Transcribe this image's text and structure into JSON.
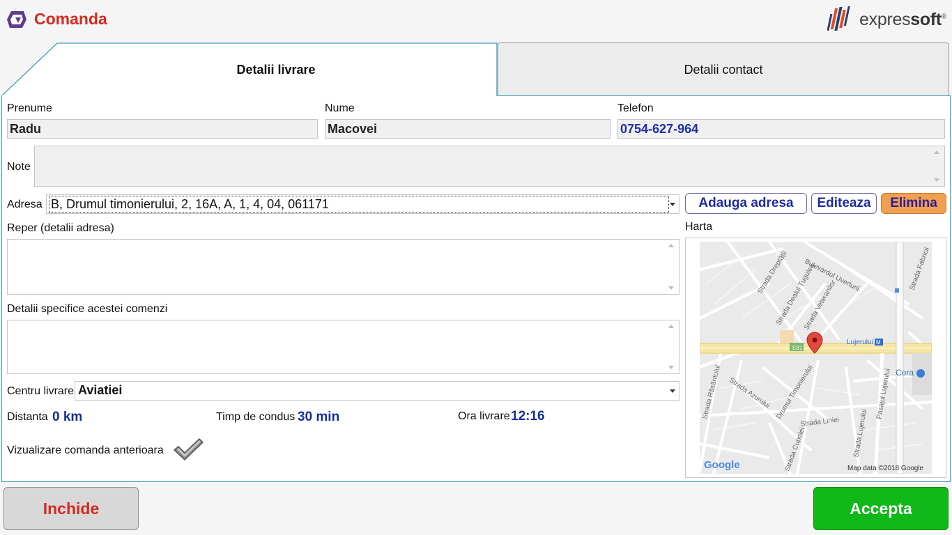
{
  "header": {
    "title": "Comanda",
    "brand_light": "expres",
    "brand_bold": "soft",
    "brand_mark": "®"
  },
  "tabs": [
    {
      "label": "Detalii livrare",
      "active": true
    },
    {
      "label": "Detalii contact",
      "active": false
    }
  ],
  "form": {
    "prenume_label": "Prenume",
    "prenume_value": "Radu",
    "nume_label": "Nume",
    "nume_value": "Macovei",
    "telefon_label": "Telefon",
    "telefon_value": "0754-627-964",
    "note_label": "Note",
    "adresa_label": "Adresa",
    "adresa_value": "B, Drumul timonierului, 2, 16A, A, 1, 4, 04, 061171",
    "reper_label": "Reper (detalii adresa)",
    "detalii_label": "Detalii specifice acestei comenzi",
    "centru_label": "Centru livrare",
    "centru_value": "Aviatiei",
    "distanta_label": "Distanta",
    "distanta_value": "0 km",
    "timp_label": "Timp de condus",
    "timp_value": "30 min",
    "ora_label": "Ora livrare",
    "ora_value": "12:16",
    "vizualizare_label": "Vizualizare comanda anterioara"
  },
  "buttons": {
    "adauga": "Adauga adresa",
    "editeaza": "Editeaza",
    "elimina": "Elimina",
    "inchide": "Inchide",
    "accepta": "Accepta"
  },
  "map": {
    "label": "Harta",
    "streets": [
      "Bulevardul Uverturii",
      "Strada Dreptății",
      "Strada Dealul Țugulea",
      "Strada Veteranilor",
      "Strada Fabricii",
      "Lujerului",
      "Cora",
      "Strada Răsăritului",
      "Strada Azurului",
      "Drumul Timonierului",
      "Strada Liniei",
      "Strada Cupolei",
      "Strada Lujerului",
      "Pasajul Lujerului"
    ],
    "road_badge": "E81",
    "metro_icon": "M",
    "google": "Google",
    "attribution": "Map data ©2018 Google"
  },
  "colors": {
    "accent_red": "#d42a1f",
    "accept_green": "#10b818",
    "panel_border": "#3da0b0",
    "value_blue": "#152d9c",
    "delete_orange": "#f0a050"
  },
  "icons": {
    "logo": "hexagon-logo-icon",
    "brand": "expressoft-bars-icon",
    "check": "checkmark-icon",
    "pin": "map-pin-icon"
  }
}
